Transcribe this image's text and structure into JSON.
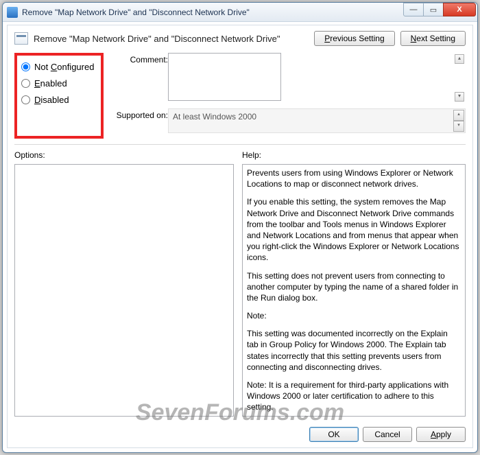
{
  "window": {
    "title": "Remove \"Map Network Drive\" and \"Disconnect Network Drive\""
  },
  "header": {
    "policy_title": "Remove \"Map Network Drive\" and \"Disconnect Network Drive\"",
    "prev_btn": "Previous Setting",
    "next_btn": "Next Setting"
  },
  "state": {
    "options": [
      {
        "label_pre": "Not ",
        "label_u": "C",
        "label_post": "onfigured",
        "checked": true
      },
      {
        "label_pre": "",
        "label_u": "E",
        "label_post": "nabled",
        "checked": false
      },
      {
        "label_pre": "",
        "label_u": "D",
        "label_post": "isabled",
        "checked": false
      }
    ]
  },
  "labels": {
    "comment": "Comment:",
    "supported": "Supported on:",
    "options": "Options:",
    "help": "Help:"
  },
  "comment_value": "",
  "supported_value": "At least Windows 2000",
  "help_paragraphs": [
    "Prevents users from using Windows Explorer or Network Locations to map or disconnect network drives.",
    "If you enable this setting, the system removes the Map Network Drive and Disconnect Network Drive commands from the toolbar and Tools menus in Windows Explorer and Network Locations and from menus that appear when you right-click the Windows Explorer or Network Locations icons.",
    "This setting does not prevent users from connecting to another computer by typing the name of a shared folder in the Run dialog box.",
    "Note:",
    "This setting was documented incorrectly on the Explain tab in Group Policy for Windows 2000. The Explain tab states incorrectly that this setting prevents users from connecting and disconnecting drives.",
    "Note: It is a requirement for third-party applications with Windows 2000 or later certification to adhere to this setting."
  ],
  "footer": {
    "ok": "OK",
    "cancel": "Cancel",
    "apply": "Apply"
  },
  "watermark": "SevenForums.com"
}
